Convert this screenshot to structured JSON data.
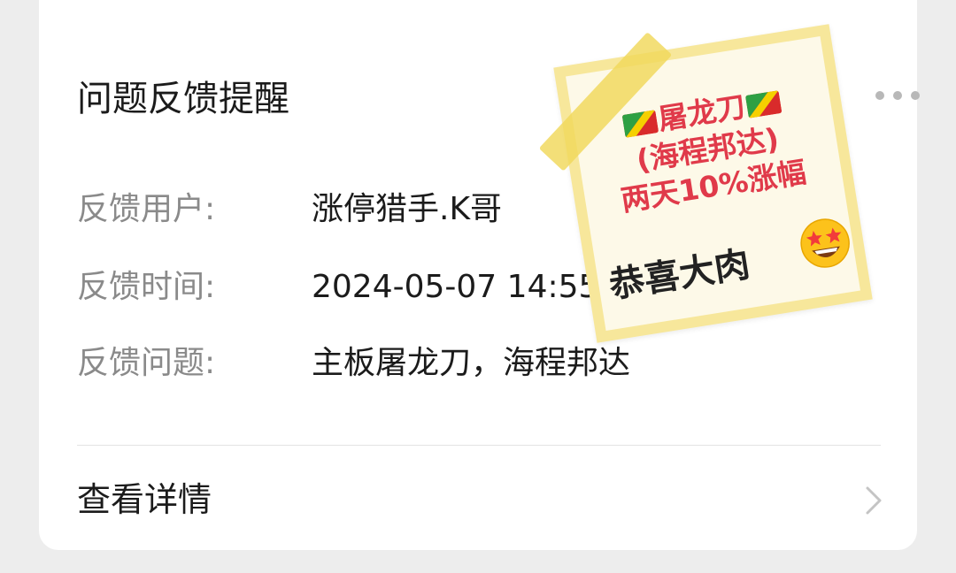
{
  "card": {
    "title": "问题反馈提醒",
    "rows": [
      {
        "label": "反馈用户:",
        "value": "涨停猎手.K哥"
      },
      {
        "label": "反馈时间:",
        "value": "2024-05-07 14:55:30"
      },
      {
        "label": "反馈问题:",
        "value": "主板屠龙刀，海程邦达"
      }
    ],
    "details_label": "查看详情"
  },
  "sticker": {
    "line1": "屠龙刀",
    "line2": "(海程邦达)",
    "line3": "两天10%涨幅",
    "footer": "恭喜大肉",
    "flag_icon": "congo-flag-icon",
    "emoji_icon": "star-struck-emoji-icon"
  },
  "colors": {
    "background": "#ededed",
    "card": "#ffffff",
    "label": "#8a8a8a",
    "text": "#1b1b1b",
    "sticker_red": "#e03a4a",
    "sticker_border": "#f7e79b"
  }
}
